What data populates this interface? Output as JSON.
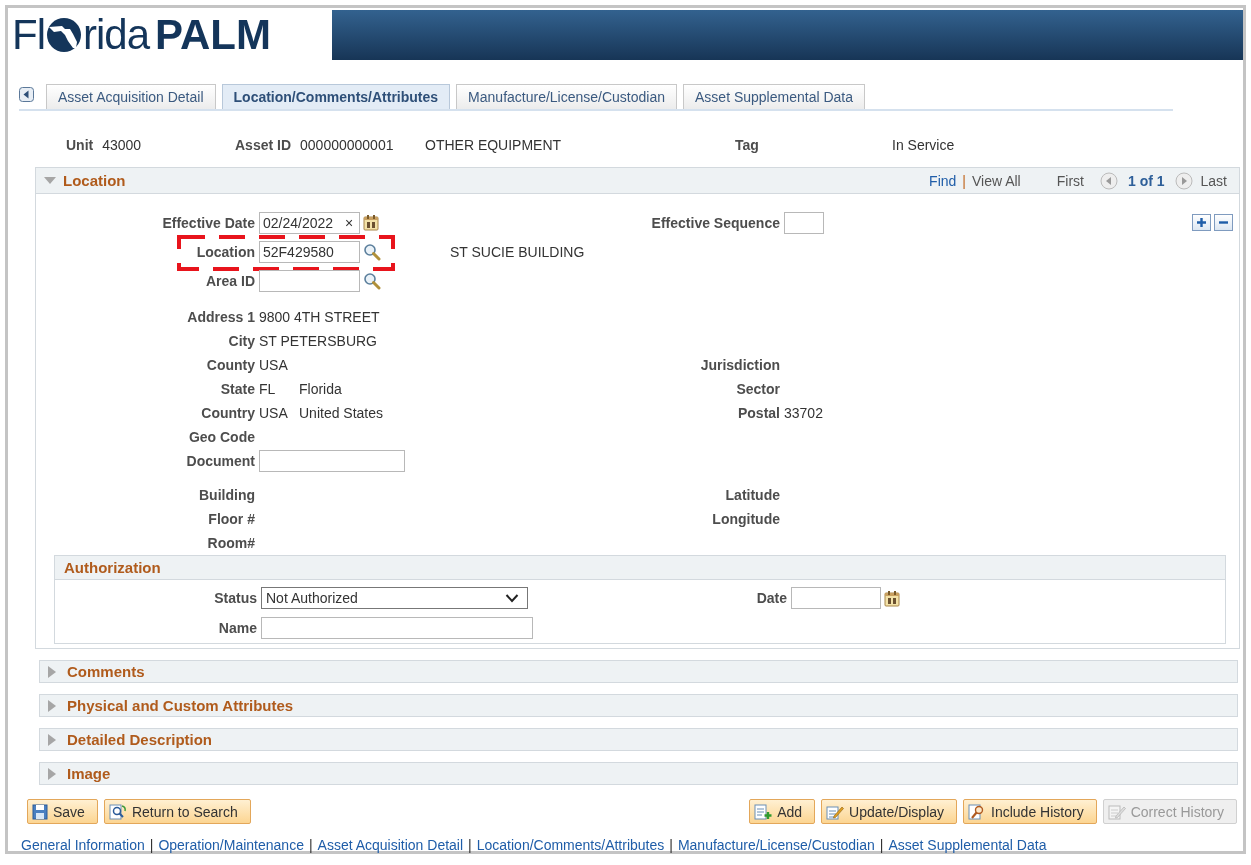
{
  "header": {
    "logo": {
      "text_before": "Fl",
      "text_after": "rida",
      "text_bold": "PALM"
    }
  },
  "tabs": [
    {
      "label": "Asset Acquisition Detail",
      "selected": false
    },
    {
      "label": "Location/Comments/Attributes",
      "selected": true
    },
    {
      "label": "Manufacture/License/Custodian",
      "selected": false
    },
    {
      "label": "Asset Supplemental Data",
      "selected": false
    }
  ],
  "summary": [
    {
      "label": "Unit",
      "value": "43000"
    },
    {
      "label": "Asset ID",
      "value": "000000000001"
    },
    {
      "value": "OTHER EQUIPMENT"
    },
    {
      "label": "Tag"
    },
    {
      "value": "In Service"
    }
  ],
  "location": {
    "title": "Location",
    "expanded": true,
    "nav": {
      "find": "Find",
      "separator": "|",
      "view_all": "View All",
      "first": "First",
      "counter": "1 of 1",
      "last": "Last"
    },
    "rows": [
      {
        "left": {
          "label": "Effective Date",
          "kind": "date",
          "value": "02/24/2022",
          "clear": "×"
        },
        "right": {
          "label": "Effective Sequence",
          "kind": "input"
        }
      },
      {
        "left": {
          "label": "Location",
          "kind": "lookup",
          "value": "52F429580",
          "highlighted": true,
          "description": "ST SUCIE BUILDING"
        }
      },
      {
        "left": {
          "label": "Area ID",
          "kind": "lookup",
          "highlighted": false
        }
      },
      {
        "left": {
          "label": "Address 1",
          "kind": "display",
          "values": [
            "9800 4TH STREET"
          ]
        }
      },
      {
        "left": {
          "label": "City",
          "kind": "display",
          "values": [
            "ST PETERSBURG"
          ]
        }
      },
      {
        "left": {
          "label": "County",
          "kind": "display",
          "values": [
            "USA"
          ]
        },
        "right": {
          "label": "Jurisdiction",
          "kind": "display"
        }
      },
      {
        "left": {
          "label": "State",
          "kind": "display",
          "values": [
            "FL",
            "Florida"
          ]
        },
        "right": {
          "label": "Sector",
          "kind": "display"
        }
      },
      {
        "left": {
          "label": "Country",
          "kind": "display",
          "values": [
            "USA",
            "United States"
          ]
        },
        "right": {
          "label": "Postal",
          "kind": "display",
          "values": [
            "33702"
          ]
        }
      },
      {
        "left": {
          "label": "Geo Code",
          "kind": "display"
        }
      },
      {
        "left": {
          "label": "Document",
          "kind": "input"
        }
      },
      {
        "left": {
          "label": "Building",
          "kind": "display"
        },
        "right": {
          "label": "Latitude",
          "kind": "display"
        }
      },
      {
        "left": {
          "label": "Floor #",
          "kind": "display"
        },
        "right": {
          "label": "Longitude",
          "kind": "display"
        }
      },
      {
        "left": {
          "label": "Room#",
          "kind": "display"
        }
      }
    ]
  },
  "authorization": {
    "title": "Authorization",
    "status": {
      "label": "Status",
      "value": "Not Authorized"
    },
    "name": {
      "label": "Name"
    },
    "date": {
      "label": "Date"
    }
  },
  "sections": [
    {
      "title": "Comments",
      "expanded": false
    },
    {
      "title": "Physical and Custom Attributes",
      "expanded": false
    },
    {
      "title": "Detailed Description",
      "expanded": false
    },
    {
      "title": "Image",
      "expanded": false
    }
  ],
  "buttons_left": [
    {
      "label": "Save",
      "kind": "save",
      "disabled": false
    },
    {
      "label": "Return to Search",
      "kind": "search",
      "disabled": false
    }
  ],
  "buttons_right": [
    {
      "label": "Add",
      "kind": "add",
      "disabled": false
    },
    {
      "label": "Update/Display",
      "kind": "update",
      "disabled": false
    },
    {
      "label": "Include History",
      "kind": "history",
      "disabled": false
    },
    {
      "label": "Correct History",
      "kind": "correct",
      "disabled": true
    }
  ],
  "footer_links": {
    "separator": "|",
    "links": [
      "General Information",
      "Operation/Maintenance",
      "Asset Acquisition Detail",
      "Location/Comments/Attributes",
      "Manufacture/License/Custodian",
      "Asset Supplemental Data"
    ]
  }
}
